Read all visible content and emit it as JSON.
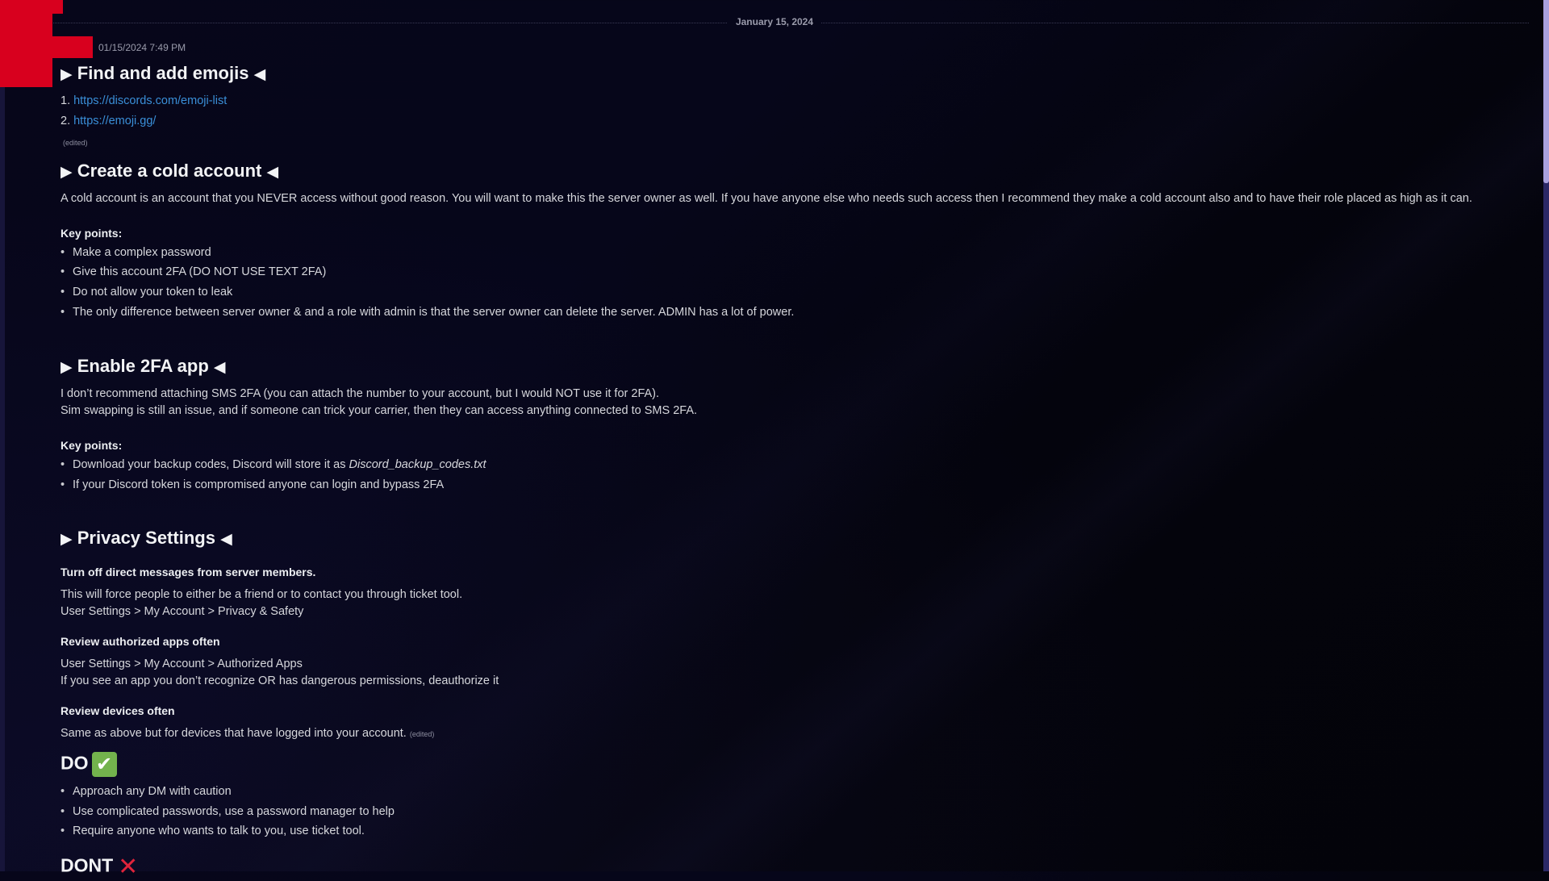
{
  "date_divider": "January 15, 2024",
  "message": {
    "timestamp": "01/15/2024 7:49 PM",
    "sections": {
      "emojis": {
        "heading": "Find and add emojis",
        "links": [
          {
            "num": "1.",
            "url": "https://discords.com/emoji-list"
          },
          {
            "num": "2.",
            "url": "https://emoji.gg/"
          }
        ],
        "edited": "(edited)"
      },
      "cold_account": {
        "heading": "Create a cold account",
        "paragraph": "A cold account is an account that you NEVER access without good reason. You will want to make this the server owner as well. If you have anyone else who needs such access then I recommend they make a cold account also and to have their role placed as high as it can.",
        "key_points_label": "Key points:",
        "bullets": [
          "Make a complex password",
          "Give this account 2FA (DO NOT USE TEXT 2FA)",
          "Do not allow your token to leak",
          "The only difference between server owner & and a role with admin is that the server owner can delete the server. ADMIN has a lot of power."
        ]
      },
      "twofa": {
        "heading": "Enable 2FA app",
        "lines": [
          "I don’t recommend attaching SMS 2FA (you can attach the number to your account, but I would NOT use it for 2FA).",
          "Sim swapping is still an issue, and if someone can trick your carrier, then they can access anything connected to SMS 2FA."
        ],
        "key_points_label": "Key points:",
        "bullet1_prefix": "Download your backup codes, Discord will store it as ",
        "bullet1_italic": "Discord_backup_codes.txt",
        "bullet2": "If your Discord token is compromised anyone can login and bypass 2FA"
      },
      "privacy": {
        "heading": "Privacy Settings",
        "dm_title": "Turn off direct messages from server members.",
        "dm_lines": [
          "This will force people to either be a friend or to contact you through ticket tool.",
          "User Settings > My Account > Privacy & Safety"
        ],
        "apps_title": "Review authorized apps often",
        "apps_lines": [
          "User Settings > My Account > Authorized Apps",
          "If you see an app you don’t recognize OR has dangerous permissions, deauthorize it"
        ],
        "devices_title": "Review devices often",
        "devices_line": "Same as above but for devices that have logged into your account.",
        "devices_edited": "(edited)"
      },
      "do": {
        "label": "DO",
        "emoji": "✔",
        "bullets": [
          "Approach any DM with caution",
          "Use complicated passwords, use a password manager to help",
          "Require anyone who wants to talk to you, use ticket tool."
        ]
      },
      "dont": {
        "label": "DONT",
        "emoji": "✕"
      }
    }
  },
  "glyphs": {
    "tri_right": "▶",
    "tri_left": "◀"
  },
  "colors": {
    "link": "#3a8fd8",
    "redaction": "#d8001e",
    "check_bg": "#73b34d",
    "cross": "#e0243b",
    "scroll_thumb": "#a9a1de",
    "scroll_track": "#2b2866"
  }
}
